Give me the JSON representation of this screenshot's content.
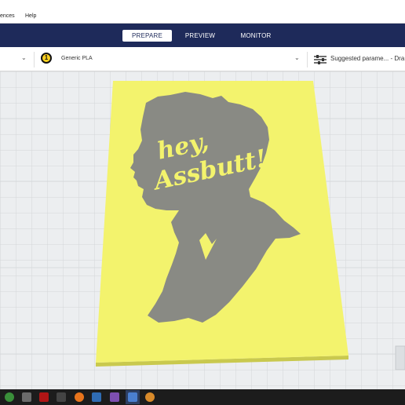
{
  "menu": {
    "items": [
      "ences",
      "Help"
    ]
  },
  "stages": {
    "prepare": "PREPARE",
    "preview": "PREVIEW",
    "monitor": "MONITOR"
  },
  "toolbar": {
    "extruder_number": "1",
    "material": "Generic PLA",
    "settings_summary": "Suggested parame... - Dra"
  },
  "model": {
    "text_line1": "hey,",
    "text_line2": "Assbutt!"
  },
  "colors": {
    "stage_bar": "#1e2a5a",
    "model_yellow": "#f4f46e",
    "silhouette": "#8a8c85",
    "grid": "#d6d9dc"
  },
  "icons": [
    "extruder-icon",
    "settings-sliders-icon",
    "chevron-down-icon",
    "xbox-icon",
    "windows-icon"
  ]
}
